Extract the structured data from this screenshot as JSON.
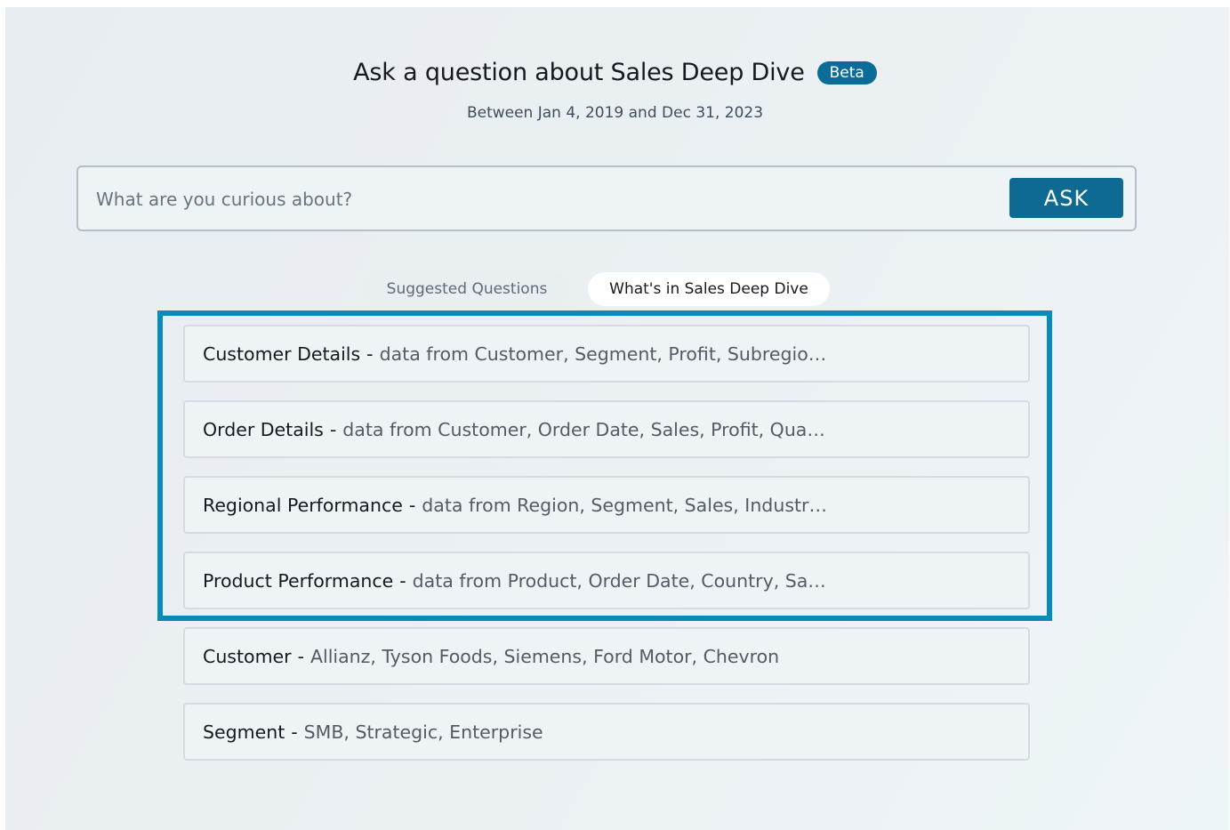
{
  "header": {
    "title": "Ask a question about Sales Deep Dive",
    "badge": "Beta",
    "subtitle": "Between Jan 4, 2019 and Dec 31, 2023"
  },
  "search": {
    "placeholder": "What are you curious about?",
    "value": "",
    "button_label": "ASK"
  },
  "tabs": [
    {
      "label": "Suggested Questions",
      "active": false
    },
    {
      "label": "What's in Sales Deep Dive",
      "active": true
    }
  ],
  "items": [
    {
      "name": "Customer Details",
      "separator": "-",
      "desc": "data from Customer, Segment, Profit, Subregio…"
    },
    {
      "name": "Order Details",
      "separator": "-",
      "desc": "data from Customer, Order Date, Sales, Profit, Qua…"
    },
    {
      "name": "Regional Performance",
      "separator": "-",
      "desc": "data from Region, Segment, Sales, Industr…"
    },
    {
      "name": "Product Performance",
      "separator": "-",
      "desc": "data from Product, Order Date, Country, Sa…"
    },
    {
      "name": "Customer",
      "separator": "-",
      "desc": "Allianz, Tyson Foods, Siemens, Ford Motor, Chevron"
    },
    {
      "name": "Segment",
      "separator": "-",
      "desc": "SMB, Strategic, Enterprise"
    }
  ],
  "colors": {
    "accent": "#0f6a93",
    "highlight": "#0a8ab9",
    "background": "#ebf0f3"
  }
}
